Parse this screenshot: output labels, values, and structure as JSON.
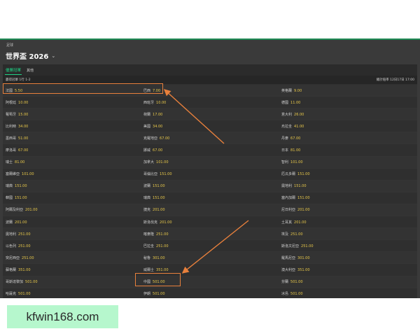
{
  "breadcrumb": "足球",
  "title": "世界盃 2026",
  "tabs": {
    "active": "優勝冠軍",
    "other": "其他"
  },
  "subbar": {
    "left": "贏得冠軍 1行 1-2",
    "right": "總計賠率 12日17日 17:00"
  },
  "teams": [
    [
      "法國",
      "5.50"
    ],
    [
      "巴西",
      "7.00"
    ],
    [
      "英格蘭",
      "9.00"
    ],
    [
      "阿根廷",
      "10.00"
    ],
    [
      "西班牙",
      "10.00"
    ],
    [
      "德國",
      "11.00"
    ],
    [
      "葡萄牙",
      "15.00"
    ],
    [
      "荷蘭",
      "17.00"
    ],
    [
      "意大利",
      "26.00"
    ],
    [
      "比利時",
      "34.00"
    ],
    [
      "美國",
      "34.00"
    ],
    [
      "烏拉圭",
      "41.00"
    ],
    [
      "墨西哥",
      "51.00"
    ],
    [
      "克羅地亞",
      "67.00"
    ],
    [
      "丹麥",
      "67.00"
    ],
    [
      "摩洛哥",
      "67.00"
    ],
    [
      "挪威",
      "67.00"
    ],
    [
      "日本",
      "81.00"
    ],
    [
      "瑞士",
      "81.00"
    ],
    [
      "加拿大",
      "101.00"
    ],
    [
      "智利",
      "101.00"
    ],
    [
      "塞爾維亞",
      "101.00"
    ],
    [
      "哥倫比亞",
      "151.00"
    ],
    [
      "厄瓜多爾",
      "151.00"
    ],
    [
      "瑞典",
      "151.00"
    ],
    [
      "波蘭",
      "151.00"
    ],
    [
      "奧地利",
      "151.00"
    ],
    [
      "韓國",
      "151.00"
    ],
    [
      "瑞典",
      "151.00"
    ],
    [
      "塞內加爾",
      "151.00"
    ],
    [
      "阿爾及利亞",
      "201.00"
    ],
    [
      "捷克",
      "201.00"
    ],
    [
      "尼日利亞",
      "201.00"
    ],
    [
      "波蘭",
      "201.00"
    ],
    [
      "斯洛伐克",
      "201.00"
    ],
    [
      "土耳其",
      "201.00"
    ],
    [
      "奧地利",
      "251.00"
    ],
    [
      "喀麥隆",
      "251.00"
    ],
    [
      "埃及",
      "251.00"
    ],
    [
      "以色列",
      "251.00"
    ],
    [
      "巴拉圭",
      "251.00"
    ],
    [
      "斯洛文尼亞",
      "251.00"
    ],
    [
      "突尼西亞",
      "251.00"
    ],
    [
      "秘魯",
      "301.00"
    ],
    [
      "羅馬尼亞",
      "301.00"
    ],
    [
      "蘇格蘭",
      "351.00"
    ],
    [
      "威爾士",
      "351.00"
    ],
    [
      "澳大利亞",
      "351.00"
    ],
    [
      "哥斯達黎加",
      "501.00"
    ],
    [
      "中國",
      "501.00"
    ],
    [
      "芬蘭",
      "501.00"
    ],
    [
      "哈薩克",
      "501.00"
    ],
    [
      "伊朗",
      "501.00"
    ],
    [
      "冰島",
      "501.00"
    ]
  ],
  "watermark": "kfwin168.com",
  "colors": {
    "accent": "#1fd084",
    "odds": "#e8c84a",
    "highlight": "#e8803c"
  }
}
